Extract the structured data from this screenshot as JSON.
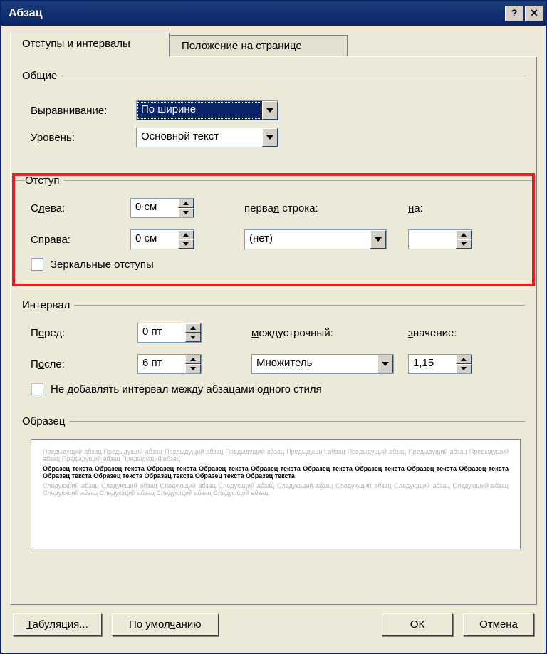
{
  "title": "Абзац",
  "tabs": {
    "active": "Отступы и интервалы",
    "inactive": "Положение на странице"
  },
  "groups": {
    "general": {
      "legend": "Общие",
      "alignment_label": "Выравнивание:",
      "alignment_value": "По ширине",
      "level_label": "Уровень:",
      "level_value": "Основной текст"
    },
    "indent": {
      "legend": "Отступ",
      "left_label": "Слева:",
      "left_value": "0 см",
      "right_label": "Справа:",
      "right_value": "0 см",
      "firstline_label": "первая строка:",
      "firstline_value": "(нет)",
      "by_label": "на:",
      "by_value": "",
      "mirror_label": "Зеркальные отступы"
    },
    "spacing": {
      "legend": "Интервал",
      "before_label": "Перед:",
      "before_value": "0 пт",
      "after_label": "После:",
      "after_value": "6 пт",
      "line_label": "междустрочный:",
      "line_value": "Множитель",
      "at_label": "значение:",
      "at_value": "1,15",
      "noadd_label": "Не добавлять интервал между абзацами одного стиля"
    },
    "preview": {
      "legend": "Образец",
      "prev_text": "Предыдущий абзац Предыдущий абзац Предыдущий абзац Предыдущий абзац Предыдущий абзац Предыдущий абзац Предыдущий абзац Предыдущий абзац Предыдущий абзац Предыдущий абзац",
      "sample_text": "Образец текста Образец текста Образец текста Образец текста Образец текста Образец текста Образец текста Образец текста Образец текста Образец текста Образец текста Образец текста Образец текста Образец текста",
      "next_text": "Следующий абзац Следующий абзац Следующий абзац Следующий абзац Следующий абзац Следующий абзац Следующий абзац Следующий абзац Следующий абзац Следующий абзац Следующий абзац Следующий абзац"
    }
  },
  "buttons": {
    "tabs": "Табуляция...",
    "default": "По умолчанию",
    "ok": "ОК",
    "cancel": "Отмена"
  }
}
